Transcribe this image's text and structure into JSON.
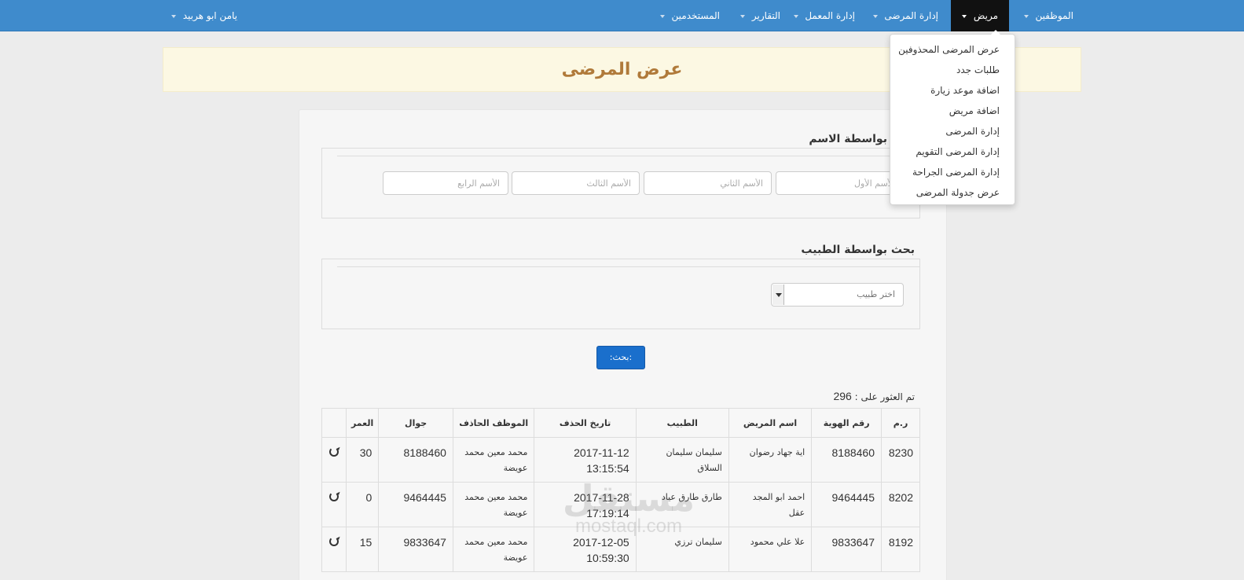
{
  "navbar": {
    "items": [
      {
        "label": "الموظفين"
      },
      {
        "label": "مريض"
      },
      {
        "label": "إدارة المرضى"
      },
      {
        "label": "إدارة المعمل"
      },
      {
        "label": "التقارير"
      },
      {
        "label": "المستخدمين"
      }
    ],
    "user": {
      "label": "يامن ابو هربيد"
    }
  },
  "dropdown": {
    "items": [
      {
        "label": "عرض المرضى المحذوفين"
      },
      {
        "label": "طلبات جدد"
      },
      {
        "label": "اضافة موعد زيارة"
      },
      {
        "label": "اضافة مريض"
      },
      {
        "label": "إدارة المرضى"
      },
      {
        "label": "إدارة المرضى التقويم"
      },
      {
        "label": "إدارة المرضى الجراحة"
      },
      {
        "label": "عرض جدولة المرضى"
      }
    ]
  },
  "page": {
    "title": "عرض المرضى"
  },
  "search_name": {
    "legend": "بحث بواسطة الاسم",
    "inputs": [
      {
        "placeholder": "الأسم الأول"
      },
      {
        "placeholder": "الأسم الثاني"
      },
      {
        "placeholder": "الأسم الثالث"
      },
      {
        "placeholder": "الأسم الرابع"
      }
    ]
  },
  "search_doctor": {
    "legend": "بحث بواسطة الطبيب",
    "select_value": "اختر طبيب"
  },
  "search_button": {
    "label": ":بحث:"
  },
  "results": {
    "found_label": "تم العثور على :",
    "found_count": "296"
  },
  "table": {
    "headers": [
      "ر.م",
      "رقم الهوية",
      "اسم المريض",
      "الطبيب",
      "تاريخ الحذف",
      "الموظف الحاذف",
      "جوال",
      "العمر",
      ""
    ],
    "rows": [
      {
        "id": "8230",
        "national_id": "8188460",
        "patient": "اية جهاد رضوان",
        "doctor": "سليمان سليمان السلاق",
        "deleted_at": "2017-11-12 13:15:54",
        "employee": "محمد معين محمد عويضة",
        "mobile": "8188460",
        "age": "30"
      },
      {
        "id": "8202",
        "national_id": "9464445",
        "patient": "احمد ابو المجد عقل",
        "doctor": "طارق طارق عياد",
        "deleted_at": "2017-11-28 17:19:14",
        "employee": "محمد معين محمد عويضة",
        "mobile": "9464445",
        "age": "0"
      },
      {
        "id": "8192",
        "national_id": "9833647",
        "patient": "علا علي محمود",
        "doctor": "سليمان ترزي",
        "deleted_at": "2017-12-05 10:59:30",
        "employee": "محمد معين محمد عويضة",
        "mobile": "9833647",
        "age": "15"
      }
    ]
  },
  "watermark": {
    "arabic": "مستقل",
    "latin": "mostaql.com"
  },
  "colors": {
    "navbar": "#3f8bcc",
    "active_nav": "#111111",
    "button": "#1a6fcc",
    "banner": "#fcf8e3",
    "title": "#b07a3a"
  }
}
